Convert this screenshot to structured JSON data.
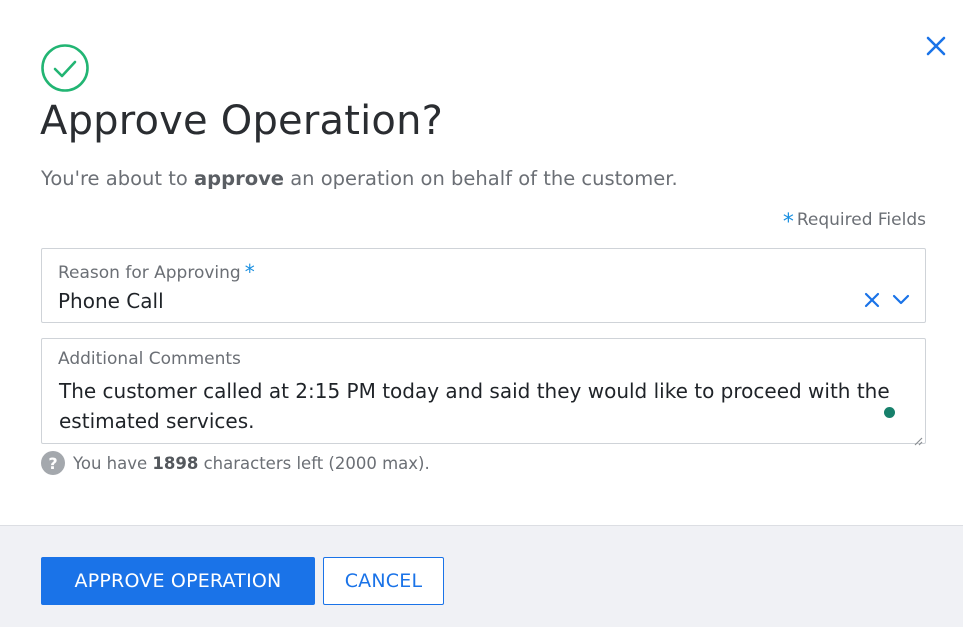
{
  "modal": {
    "title": "Approve Operation?",
    "subtitle_prefix": "You're about to ",
    "subtitle_bold": "approve",
    "subtitle_suffix": " an operation on behalf of the customer.",
    "required_note": "Required Fields",
    "required_star": "*",
    "icons": {
      "success": "check-circle-icon",
      "close": "close-icon",
      "clear": "clear-x-icon",
      "dropdown": "chevron-down-icon",
      "help": "question-circle-icon"
    },
    "colors": {
      "success": "#22b573",
      "accent": "#1a73e8",
      "required": "#1a8fe0",
      "focus_dot": "#17806b",
      "footer_bg": "#f0f1f5"
    }
  },
  "reason_field": {
    "label": "Reason for Approving",
    "required_star": "*",
    "value": "Phone Call"
  },
  "comments_field": {
    "label": "Additional Comments",
    "value": "The customer called at 2:15 PM today and said they would like to proceed with the estimated services."
  },
  "char_count": {
    "help_glyph": "?",
    "prefix": "You have ",
    "remaining": "1898",
    "suffix": " characters left (2000 max)."
  },
  "footer": {
    "approve_label": "APPROVE OPERATION",
    "cancel_label": "CANCEL"
  }
}
